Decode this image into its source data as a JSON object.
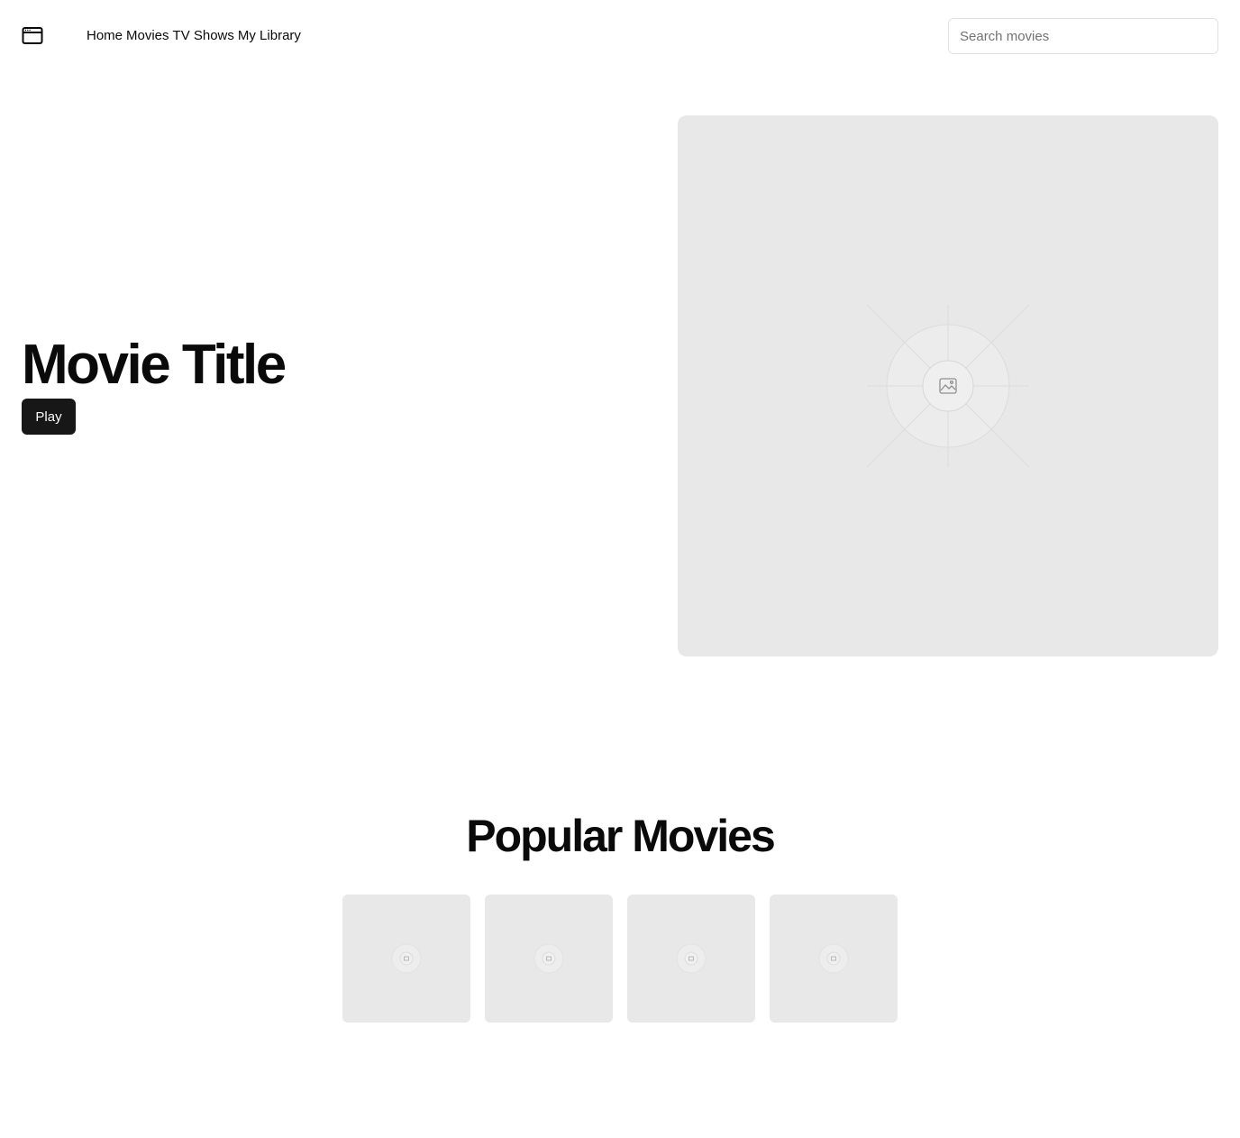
{
  "header": {
    "logo_icon": "browser-window-icon",
    "nav": [
      {
        "label": "Home"
      },
      {
        "label": "Movies"
      },
      {
        "label": "TV Shows"
      },
      {
        "label": "My Library"
      }
    ],
    "search": {
      "placeholder": "Search movies",
      "value": ""
    }
  },
  "hero": {
    "title": "Movie Title",
    "play_label": "Play",
    "image_icon": "image-placeholder-icon"
  },
  "popular": {
    "title": "Popular Movies",
    "card_icon": "image-placeholder-icon",
    "card_count": 4
  },
  "colors": {
    "primary_button": "#171717",
    "placeholder_bg": "#e8e8e8",
    "text": "#0a0a0a"
  }
}
